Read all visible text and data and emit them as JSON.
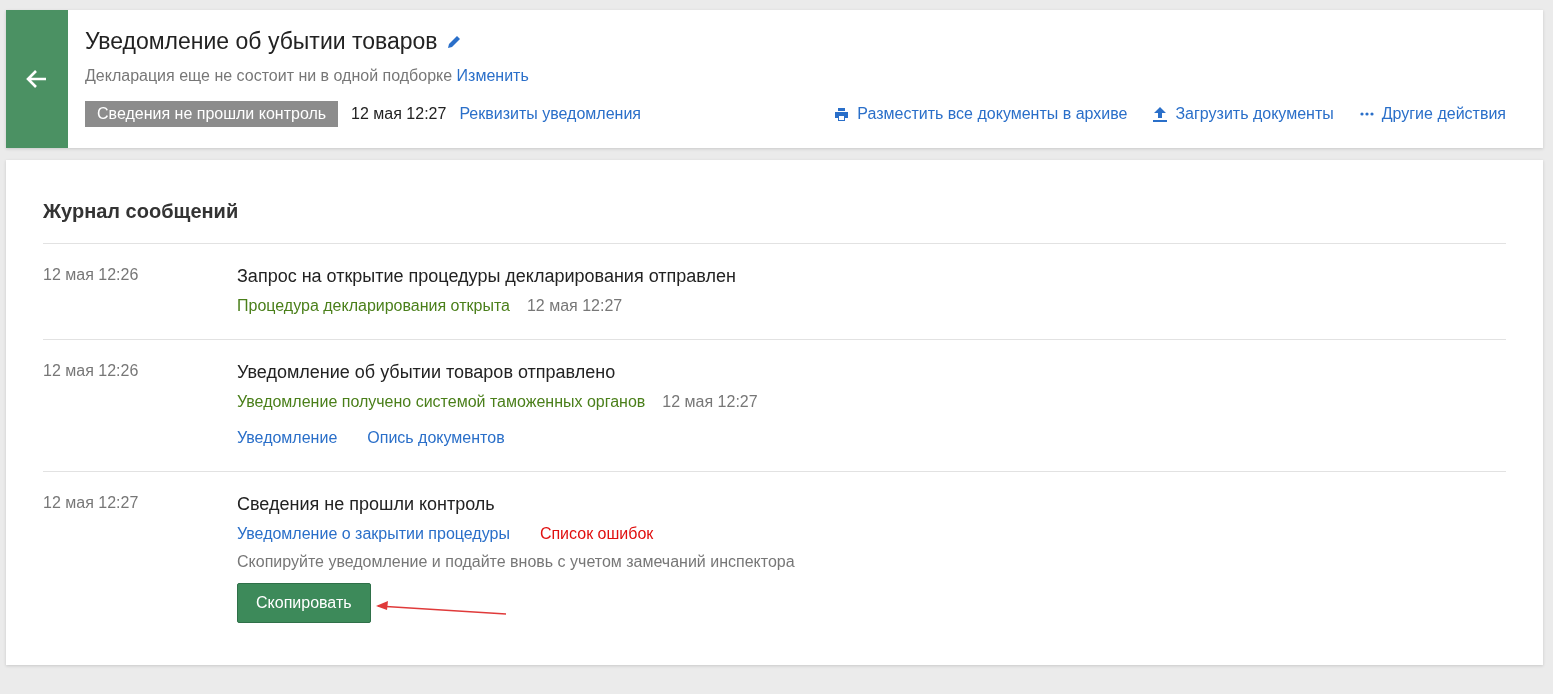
{
  "header": {
    "title": "Уведомление об убытии товаров",
    "subtitle": "Декларация еще не состоит ни в одной подборке",
    "subtitle_link": "Изменить",
    "status_badge": "Сведения не прошли контроль",
    "date": "12 мая 12:27",
    "requisites_link": "Реквизиты уведомления",
    "actions": [
      {
        "kind": "print",
        "label": "Разместить все документы в архиве"
      },
      {
        "kind": "upload",
        "label": "Загрузить документы"
      },
      {
        "kind": "more",
        "label": "Другие действия"
      }
    ]
  },
  "journal": {
    "title": "Журнал сообщений",
    "entries": [
      {
        "time": "12 мая 12:26",
        "title": "Запрос на открытие процедуры декларирования отправлен",
        "status": {
          "text": "Процедура декларирования открыта",
          "date": "12 мая 12:27"
        }
      },
      {
        "time": "12 мая 12:26",
        "title": "Уведомление об убытии товаров отправлено",
        "status": {
          "text": "Уведомление получено системой таможенных органов",
          "date": "12 мая 12:27"
        },
        "links": [
          {
            "label": "Уведомление",
            "kind": "normal"
          },
          {
            "label": "Опись документов",
            "kind": "normal"
          }
        ]
      },
      {
        "time": "12 мая 12:27",
        "title": "Сведения не прошли контроль",
        "links": [
          {
            "label": "Уведомление о закрытии процедуры",
            "kind": "normal"
          },
          {
            "label": "Список ошибок",
            "kind": "error"
          }
        ],
        "note": "Скопируйте уведомление и подайте вновь с учетом замечаний инспектора",
        "button": "Скопировать"
      }
    ]
  }
}
